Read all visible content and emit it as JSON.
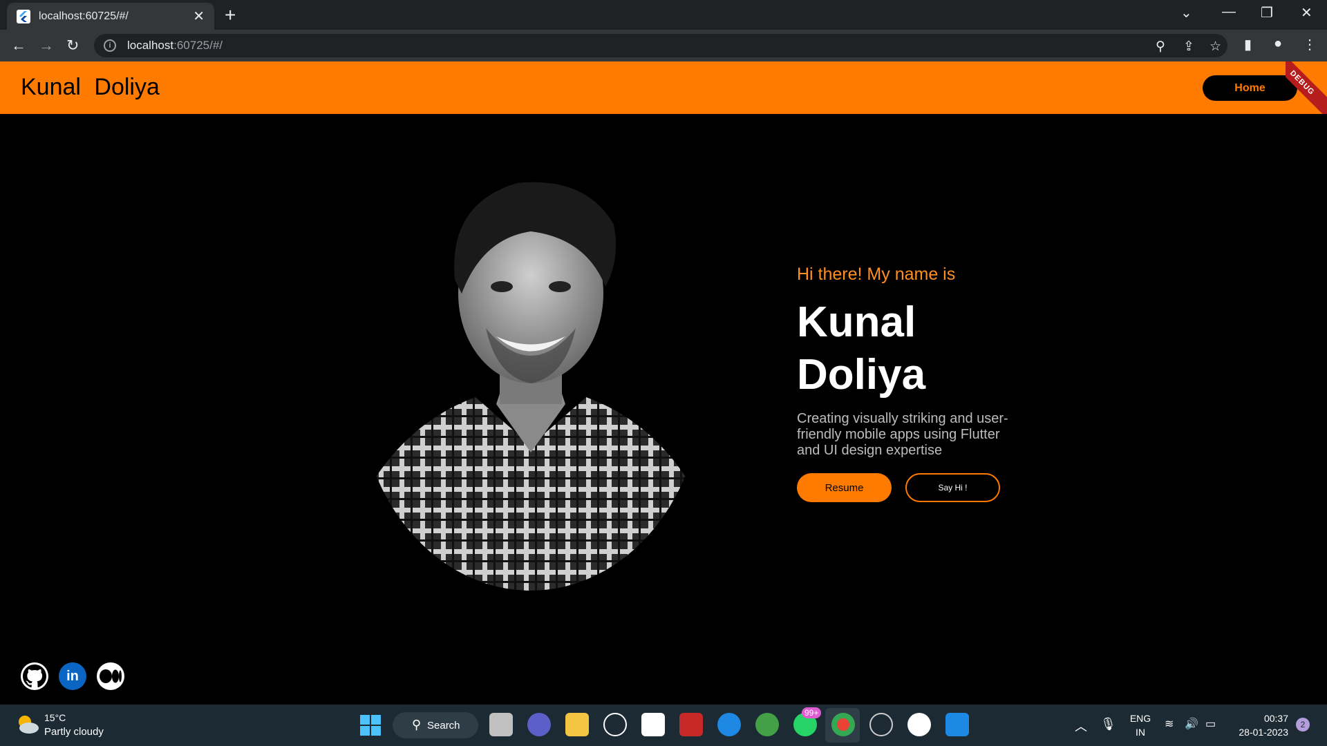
{
  "browser": {
    "tab_title": "localhost:60725/#/",
    "url_host": "localhost",
    "url_rest": ":60725/#/"
  },
  "app": {
    "brand": "Kunal  Doliya",
    "nav_home": "Home",
    "debug_banner": "DEBUG",
    "greeting": "Hi there! My name is",
    "name_line1": "Kunal",
    "name_line2": "Doliya",
    "tagline": "Creating visually striking and user-friendly mobile apps using Flutter and UI design expertise",
    "resume_label": "Resume",
    "sayhi_label": "Say Hi !",
    "accent_color": "#ff7b00",
    "social": [
      "github-icon",
      "linkedin-icon",
      "medium-icon"
    ]
  },
  "taskbar": {
    "temperature": "15°C",
    "weather": "Partly cloudy",
    "search_label": "Search",
    "whatsapp_badge": "99+",
    "lang_top": "ENG",
    "lang_bottom": "IN",
    "time": "00:37",
    "date": "28-01-2023",
    "notification_count": "2"
  }
}
